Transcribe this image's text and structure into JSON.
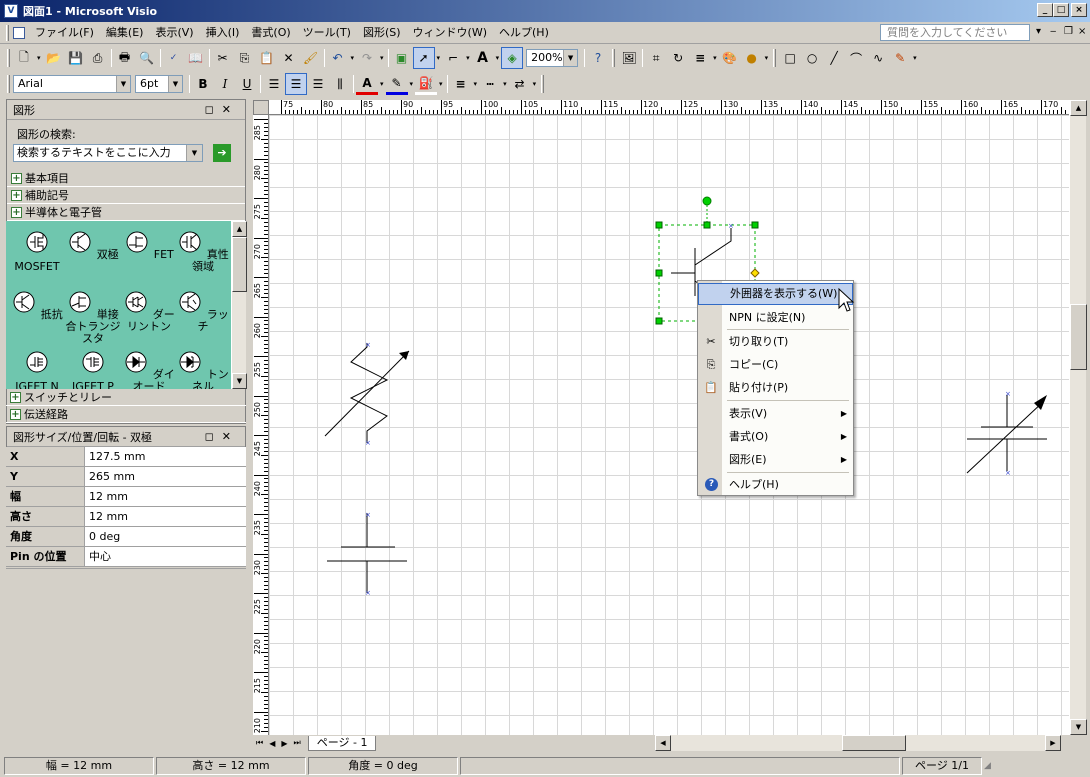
{
  "window": {
    "title": "図面1 - Microsoft Visio",
    "app_icon": "visio-icon",
    "help_placeholder": "質問を入力してください"
  },
  "menu": [
    "ファイル(F)",
    "編集(E)",
    "表示(V)",
    "挿入(I)",
    "書式(O)",
    "ツール(T)",
    "図形(S)",
    "ウィンドウ(W)",
    "ヘルプ(H)"
  ],
  "toolbar": {
    "zoom": "200%",
    "font": "Arial",
    "font_size": "6pt",
    "bold": "B",
    "italic": "I",
    "underline": "U",
    "font_color_letter": "A"
  },
  "shapes_panel": {
    "title": "図形",
    "search_label": "図形の検索:",
    "search_placeholder": "検索するテキストをここに入力",
    "categories_top": [
      "基本項目",
      "補助記号",
      "半導体と電子管"
    ],
    "stencil_items": [
      "MOSFET",
      "双極",
      "FET",
      "真性領域",
      "抵抗",
      "単接合トランジスタ",
      "ダーリントン",
      "ラッチ",
      "IGFET N",
      "IGFET P",
      "ダイオード",
      "トンネル"
    ],
    "categories_bottom": [
      "スイッチとリレー",
      "伝送経路"
    ]
  },
  "size_panel": {
    "title": "図形サイズ/位置/回転 - 双極",
    "rows": [
      {
        "key": "X",
        "value": "127.5 mm"
      },
      {
        "key": "Y",
        "value": "265 mm"
      },
      {
        "key": "幅",
        "value": "12 mm"
      },
      {
        "key": "高さ",
        "value": "12 mm"
      },
      {
        "key": "角度",
        "value": "0 deg"
      },
      {
        "key": "Pin の位置",
        "value": "中心"
      }
    ]
  },
  "ruler": {
    "h_ticks": [
      "75",
      "80",
      "85",
      "90",
      "95",
      "100",
      "105",
      "110",
      "115",
      "120",
      "125",
      "130",
      "135",
      "140",
      "145",
      "150",
      "155",
      "160",
      "165",
      "170"
    ],
    "v_ticks": [
      "285",
      "280",
      "275",
      "270",
      "265",
      "260",
      "255",
      "250",
      "245",
      "240",
      "235",
      "230",
      "225",
      "220",
      "215",
      "210"
    ]
  },
  "context_menu": {
    "items": [
      {
        "label": "外囲器を表示する(W)",
        "icon": "",
        "submenu": false,
        "highlight": true
      },
      {
        "label": "NPN に設定(N)",
        "icon": "",
        "submenu": false,
        "highlight": false
      },
      {
        "label": "切り取り(T)",
        "icon": "scissors-icon",
        "submenu": false,
        "highlight": false
      },
      {
        "label": "コピー(C)",
        "icon": "copy-icon",
        "submenu": false,
        "highlight": false
      },
      {
        "label": "貼り付け(P)",
        "icon": "paste-icon",
        "submenu": false,
        "highlight": false
      },
      {
        "label": "表示(V)",
        "icon": "",
        "submenu": true,
        "highlight": false
      },
      {
        "label": "書式(O)",
        "icon": "",
        "submenu": true,
        "highlight": false
      },
      {
        "label": "図形(E)",
        "icon": "",
        "submenu": true,
        "highlight": false
      },
      {
        "label": "ヘルプ(H)",
        "icon": "help-icon",
        "submenu": false,
        "highlight": false
      }
    ]
  },
  "tabs": {
    "page_tab": "ページ - 1"
  },
  "status": {
    "width": "幅 = 12 mm",
    "height": "高さ = 12 mm",
    "angle": "角度 = 0 deg",
    "page": "ページ 1/1"
  },
  "colors": {
    "title_start": "#0a246a",
    "title_end": "#a6caf0",
    "stencil_bg": "#6fc6ae",
    "menu_highlight": "#c1d2ee",
    "selection_handle": "#00c000"
  }
}
